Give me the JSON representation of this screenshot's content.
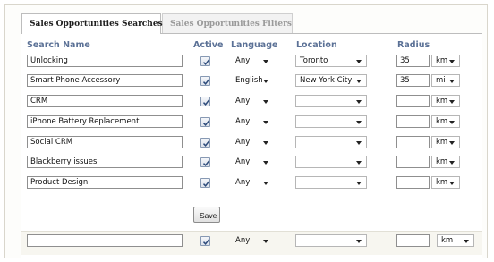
{
  "tabs": [
    {
      "label": "Sales Opportunities Searches",
      "active": true
    },
    {
      "label": "Sales Opportunities Filters",
      "active": false
    }
  ],
  "columns": {
    "search_name": "Search Name",
    "active": "Active",
    "language": "Language",
    "location": "Location",
    "radius": "Radius"
  },
  "rows": [
    {
      "name": "Unlocking",
      "active": true,
      "language": "Any",
      "location": "Toronto",
      "radius": "35",
      "unit": "km"
    },
    {
      "name": "Smart Phone Accessory",
      "active": true,
      "language": "English",
      "location": "New York City",
      "radius": "35",
      "unit": "mi"
    },
    {
      "name": "CRM",
      "active": true,
      "language": "Any",
      "location": "",
      "radius": "",
      "unit": "km"
    },
    {
      "name": "iPhone Battery Replacement",
      "active": true,
      "language": "Any",
      "location": "",
      "radius": "",
      "unit": "km"
    },
    {
      "name": "Social CRM",
      "active": true,
      "language": "Any",
      "location": "",
      "radius": "",
      "unit": "km"
    },
    {
      "name": "Blackberry issues",
      "active": true,
      "language": "Any",
      "location": "",
      "radius": "",
      "unit": "km"
    },
    {
      "name": "Product Design",
      "active": true,
      "language": "Any",
      "location": "",
      "radius": "",
      "unit": "km"
    }
  ],
  "save_label": "Save",
  "new_row": {
    "name": "",
    "active": true,
    "language": "Any",
    "location": "",
    "radius": "",
    "unit": "km"
  },
  "colors": {
    "header_text": "#5b7196",
    "checkbox_border": "#8799b3",
    "checkmark": "#2c4a7a"
  }
}
